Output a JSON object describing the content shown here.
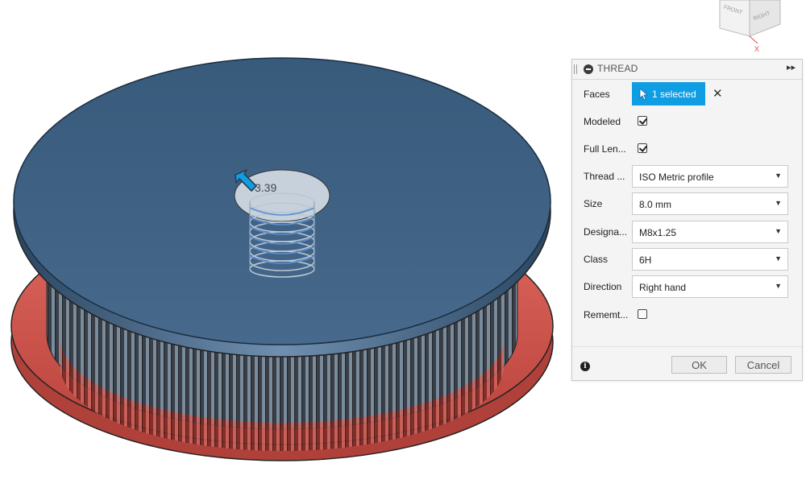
{
  "viewcube": {
    "front": "FRONT",
    "right": "RIGHT",
    "axis_x": "X"
  },
  "canvas": {
    "dimension_label": "3.39"
  },
  "dialog": {
    "title": "THREAD",
    "faces": {
      "label": "Faces",
      "selection": "1 selected"
    },
    "modeled": {
      "label": "Modeled",
      "checked": true
    },
    "full_length": {
      "label": "Full Len...",
      "checked": true
    },
    "thread_type": {
      "label": "Thread ...",
      "value": "ISO Metric profile"
    },
    "size": {
      "label": "Size",
      "value": "8.0 mm"
    },
    "designation": {
      "label": "Designa...",
      "value": "M8x1.25"
    },
    "class": {
      "label": "Class",
      "value": "6H"
    },
    "direction": {
      "label": "Direction",
      "value": "Right hand"
    },
    "remember": {
      "label": "Rememt...",
      "checked": false
    },
    "ok_label": "OK",
    "cancel_label": "Cancel"
  },
  "colors": {
    "disc_top": "#3d5f80",
    "flange": "#d0564f",
    "accent": "#0f9ee4",
    "highlight": "#f4f34a"
  }
}
